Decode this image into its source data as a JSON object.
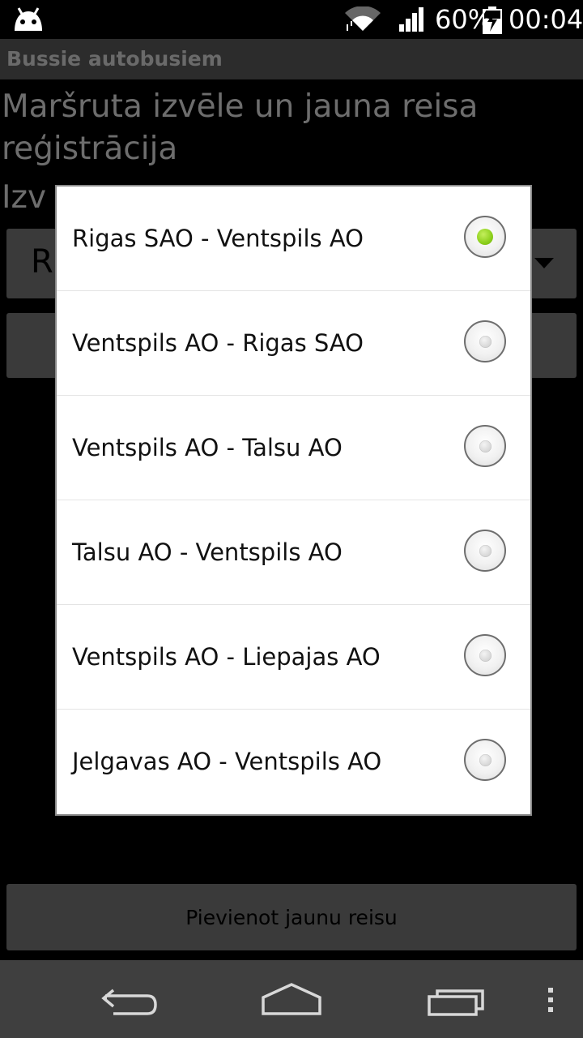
{
  "status_bar": {
    "battery_percent": "60%",
    "time": "00:04"
  },
  "action_bar": {
    "title": "Bussie autobusiem"
  },
  "main": {
    "heading": "Maršruta izvēle un jauna reisa reģistrācija",
    "select_label_visible": "Izv",
    "spinner_visible_text": "R",
    "add_trip_button": "Pievienot jaunu reisu"
  },
  "dialog": {
    "options": [
      {
        "label": "Rigas SAO - Ventspils AO",
        "checked": true
      },
      {
        "label": "Ventspils AO - Rigas SAO",
        "checked": false
      },
      {
        "label": "Ventspils AO - Talsu AO",
        "checked": false
      },
      {
        "label": "Talsu AO - Ventspils AO",
        "checked": false
      },
      {
        "label": "Ventspils AO - Liepajas AO",
        "checked": false
      },
      {
        "label": "Jelgavas AO - Ventspils AO",
        "checked": false
      }
    ]
  },
  "colors": {
    "radio_selected": "#8ccf1c",
    "dialog_background": "#ffffff",
    "nav_bar": "#3f3f3f"
  },
  "icons": {
    "status": [
      "android-icon",
      "wifi-icon",
      "signal-icon",
      "battery-charging-icon"
    ],
    "nav": [
      "back-icon",
      "home-icon",
      "recent-apps-icon",
      "overflow-menu-icon"
    ]
  }
}
